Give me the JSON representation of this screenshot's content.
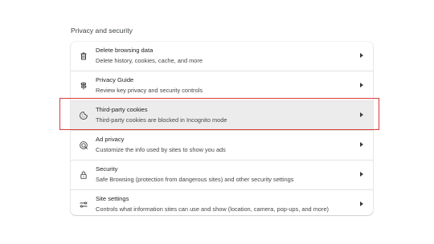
{
  "section": {
    "title": "Privacy and security"
  },
  "items": [
    {
      "title": "Delete browsing data",
      "subtitle": "Delete history, cookies, cache, and more",
      "icon": "trash-icon"
    },
    {
      "title": "Privacy Guide",
      "subtitle": "Review key privacy and security controls",
      "icon": "privacy-guide-icon"
    },
    {
      "title": "Third-party cookies",
      "subtitle": "Third-party cookies are blocked in Incognito mode",
      "icon": "cookie-icon",
      "highlighted": true
    },
    {
      "title": "Ad privacy",
      "subtitle": "Customize the info used by sites to show you ads",
      "icon": "ad-privacy-icon"
    },
    {
      "title": "Security",
      "subtitle": "Safe Browsing (protection from dangerous sites) and other security settings",
      "icon": "lock-icon"
    },
    {
      "title": "Site settings",
      "subtitle": "Controls what information sites can use and show (location, camera, pop-ups, and more)",
      "icon": "site-settings-icon"
    }
  ],
  "colors": {
    "highlight_border": "#d93b3b",
    "selected_row": "#ececec"
  }
}
